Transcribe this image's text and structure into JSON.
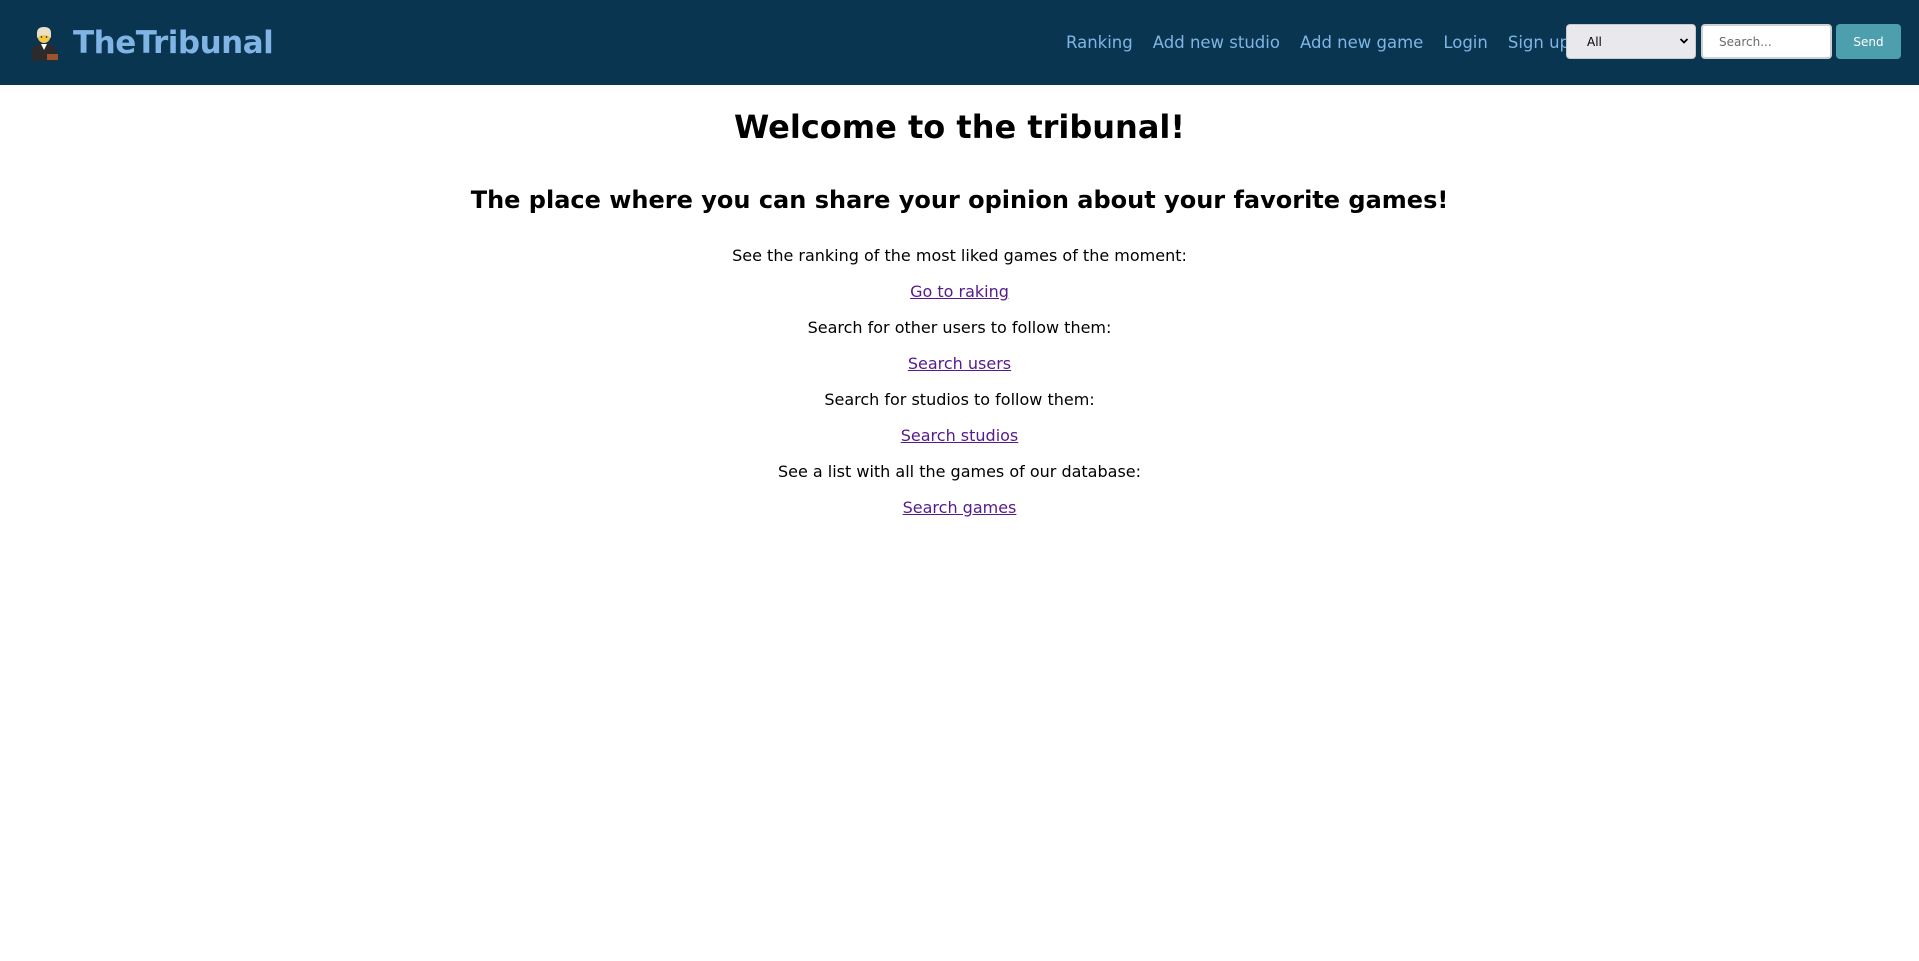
{
  "header": {
    "brand": "TheTribunal",
    "brand_icon": "judge-icon",
    "nav": [
      "Ranking",
      "Add new studio",
      "Add new game",
      "Login",
      "Sign up"
    ],
    "filter": {
      "selected": "All"
    },
    "search": {
      "placeholder": "Search..."
    },
    "send_label": "Send"
  },
  "main": {
    "title": "Welcome to the tribunal!",
    "subtitle": "The place where you can share your opinion about your favorite games!",
    "sections": [
      {
        "text": "See the ranking of the most liked games of the moment:",
        "link": "Go to raking"
      },
      {
        "text": "Search for other users to follow them:",
        "link": "Search users"
      },
      {
        "text": "Search for studios to follow them:",
        "link": "Search studios"
      },
      {
        "text": "See a list with all the games of our database:",
        "link": "Search games"
      }
    ]
  },
  "colors": {
    "navbar_bg": "#0a3551",
    "nav_text": "#7fb4e4",
    "send_button": "#4d9fad",
    "link": "#551a8b"
  }
}
